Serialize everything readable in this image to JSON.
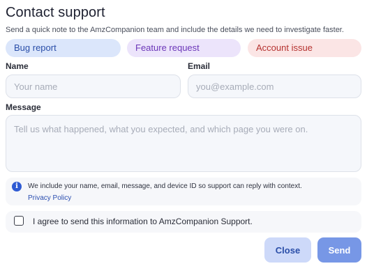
{
  "dialog": {
    "title": "Contact support",
    "subtitle": "Send a quick note to the AmzCompanion team and include the details we need to investigate faster."
  },
  "categories": [
    {
      "label": "Bug report",
      "color": "#2a4ea8",
      "background": "#dbe6fb"
    },
    {
      "label": "Feature request",
      "color": "#6b36b8",
      "background": "#ece4fb"
    },
    {
      "label": "Account issue",
      "color": "#b5322f",
      "background": "#fbe5e5"
    }
  ],
  "form": {
    "name": {
      "label": "Name",
      "value": "",
      "placeholder": "Your name"
    },
    "email": {
      "label": "Email",
      "value": "",
      "placeholder": "you@example.com"
    },
    "message": {
      "label": "Message",
      "value": "",
      "placeholder": "Tell us what happened, what you expected, and which page you were on."
    }
  },
  "notice": {
    "icon": "info-icon",
    "text": "We include your name, email, message, and device ID so support can reply with context.",
    "link_label": "Privacy Policy"
  },
  "consent": {
    "label": "I agree to send this information to AmzCompanion Support.",
    "checked": false
  },
  "actions": {
    "close_label": "Close",
    "send_label": "Send"
  },
  "colors": {
    "accent": "#2f5bd3",
    "send_button": "#7797e6",
    "close_button": "#cdd9f9"
  }
}
